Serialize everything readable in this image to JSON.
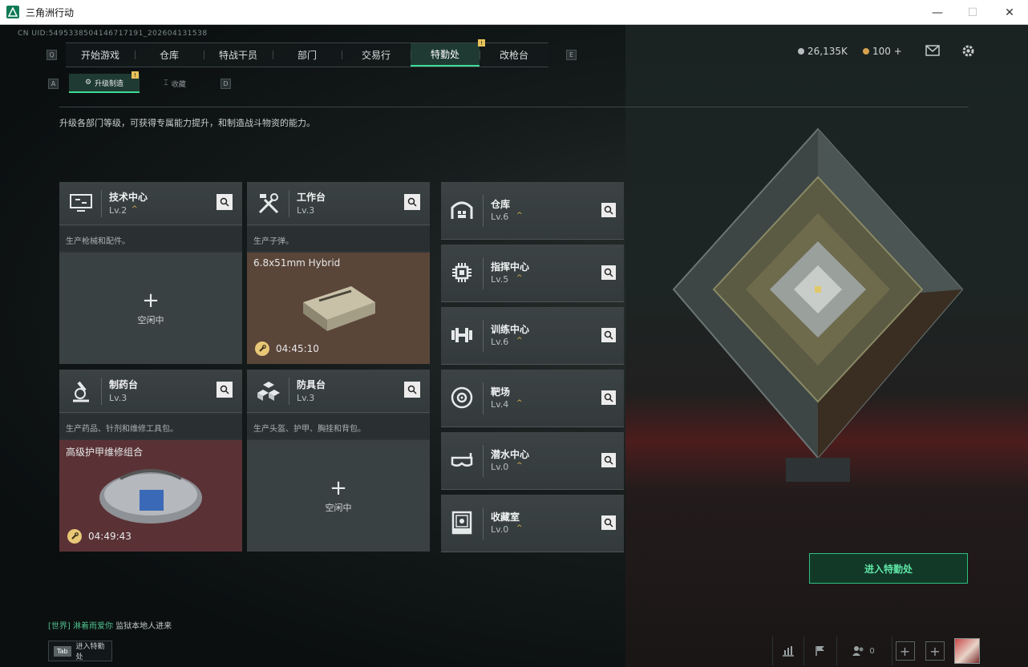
{
  "window": {
    "title": "三角洲行动",
    "minimize": "—",
    "maximize": "☐",
    "close": "✕"
  },
  "uid": "CN UID:5495338504146717191_202604131538",
  "nav": {
    "key_left": "Q",
    "key_right": "E",
    "tabs": [
      "开始游戏",
      "仓库",
      "特战干员",
      "部门",
      "交易行",
      "特勤处",
      "改枪台"
    ],
    "active_tab": "特勤处",
    "badge": "!"
  },
  "currency": {
    "coins": "26,135K",
    "tickets": "100 +"
  },
  "subnav": {
    "key_left": "A",
    "key_right": "D",
    "tabs": [
      "升级制造",
      "收藏"
    ],
    "active": "升级制造",
    "badge": "!"
  },
  "description": "升级各部门等级，可获得专属能力提升，和制造战斗物资的能力。",
  "crafting_cards": [
    {
      "name": "技术中心",
      "level": "Lv.2",
      "subtitle": "生产枪械和配件。",
      "state": "idle",
      "idle_label": "空闲中",
      "plus": "+"
    },
    {
      "name": "工作台",
      "level": "Lv.3",
      "subtitle": "生产子弹。",
      "state": "producing",
      "item": "6.8x51mm Hybrid",
      "timer": "04:45:10"
    },
    {
      "name": "制药台",
      "level": "Lv.3",
      "subtitle": "生产药品、针剂和维修工具包。",
      "state": "producing",
      "item": "高级护甲维修组合",
      "timer": "04:49:43"
    },
    {
      "name": "防具台",
      "level": "Lv.3",
      "subtitle": "生产头盔、护甲、胸挂和背包。",
      "state": "idle",
      "idle_label": "空闲中",
      "plus": "+"
    }
  ],
  "facilities": [
    {
      "name": "仓库",
      "level": "Lv.6"
    },
    {
      "name": "指挥中心",
      "level": "Lv.5"
    },
    {
      "name": "训练中心",
      "level": "Lv.6"
    },
    {
      "name": "靶场",
      "level": "Lv.4"
    },
    {
      "name": "潜水中心",
      "level": "Lv.0"
    },
    {
      "name": "收藏室",
      "level": "Lv.0"
    }
  ],
  "chevron": "^",
  "enter_button": "进入特勤处",
  "chat": {
    "channel": "[世界]",
    "user": "淋着雨爱你",
    "message": "监狱本地人进来"
  },
  "tab_hint": {
    "key": "Tab",
    "label": "进入特勤处"
  },
  "friends_count": "0",
  "colors": {
    "accent": "#3ddc97",
    "gold": "#e2b84a",
    "workbench_bg": "#5a4539",
    "pharmacy_bg": "#5a3236"
  }
}
